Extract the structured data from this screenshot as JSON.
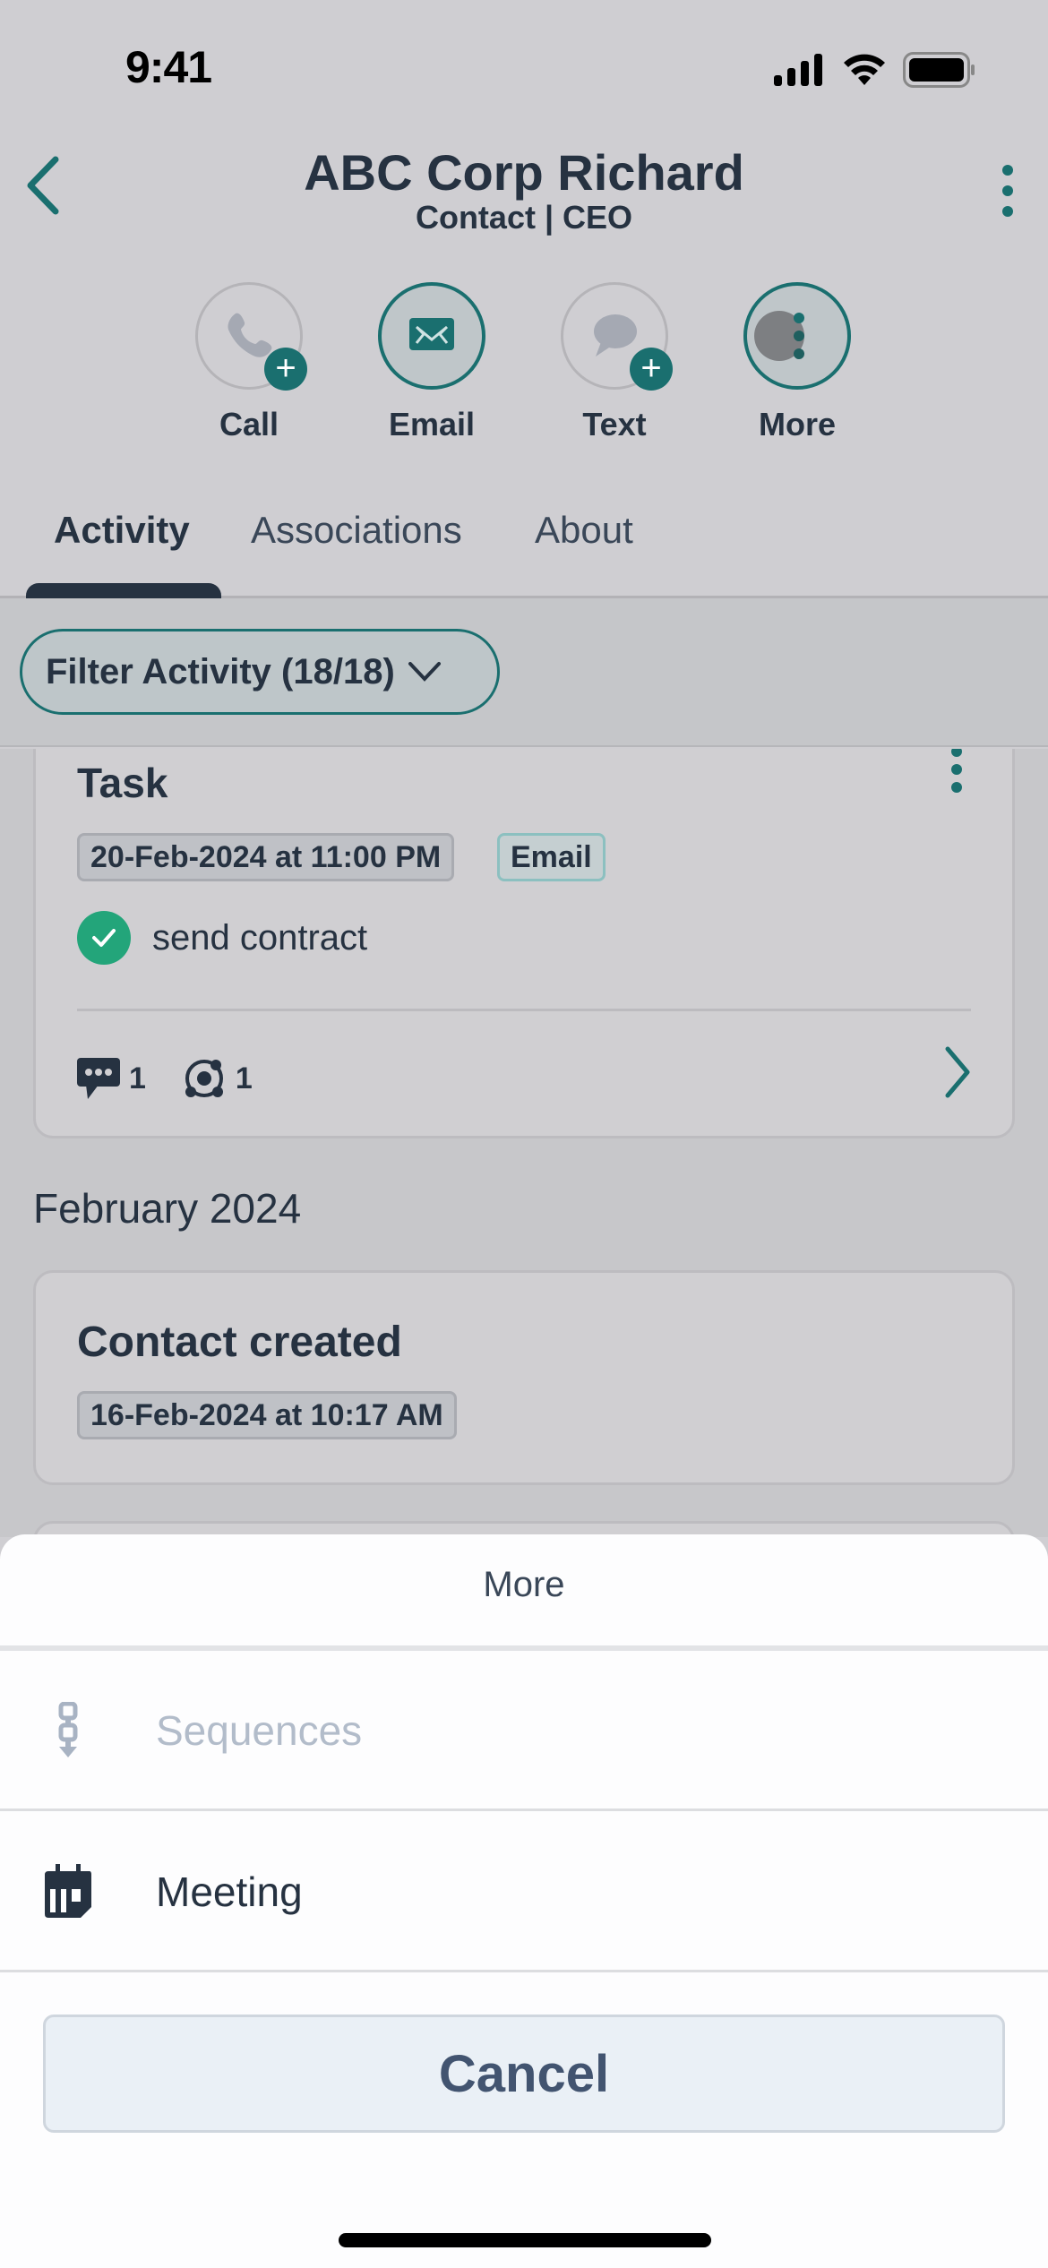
{
  "status_bar": {
    "time": "9:41"
  },
  "header": {
    "title": "ABC Corp Richard",
    "subtitle": "Contact | CEO"
  },
  "actions": [
    {
      "label": "Call",
      "icon": "phone-icon",
      "has_plus": true,
      "active": false
    },
    {
      "label": "Email",
      "icon": "mail-icon",
      "has_plus": false,
      "active": true
    },
    {
      "label": "Text",
      "icon": "chat-bubble-icon",
      "has_plus": true,
      "active": false
    },
    {
      "label": "More",
      "icon": "more-icon",
      "has_plus": false,
      "active": true
    }
  ],
  "tabs": [
    {
      "label": "Activity",
      "active": true
    },
    {
      "label": "Associations",
      "active": false
    },
    {
      "label": "About",
      "active": false
    }
  ],
  "filter": {
    "label": "Filter Activity (18/18)"
  },
  "feed": {
    "task_card": {
      "title": "Task",
      "date": "20-Feb-2024 at 11:00 PM",
      "type": "Email",
      "task_text": "send contract",
      "completed": true,
      "comments_count": "1",
      "associations_count": "1"
    },
    "month_header": "February 2024",
    "created_card": {
      "title": "Contact created",
      "date": "16-Feb-2024 at 10:17 AM"
    }
  },
  "sheet": {
    "title": "More",
    "items": [
      {
        "label": "Sequences",
        "icon": "sequences-icon",
        "disabled": true
      },
      {
        "label": "Meeting",
        "icon": "calendar-icon",
        "disabled": false
      }
    ],
    "cancel_label": "Cancel"
  },
  "colors": {
    "accent_teal": "#1a6f6f",
    "success_green": "#23a57a",
    "text_dark": "#263241",
    "disabled_text": "#b2bcca"
  }
}
